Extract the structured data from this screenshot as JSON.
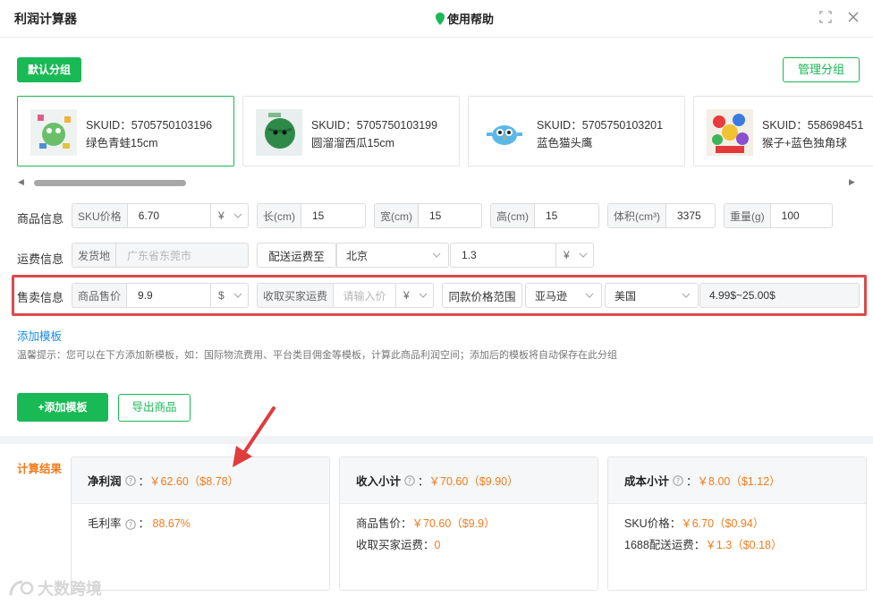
{
  "titlebar": {
    "title": "利润计算器",
    "help": "使用帮助"
  },
  "groups": {
    "default_label": "默认分组",
    "manage_label": "管理分组"
  },
  "products": [
    {
      "sku": "SKUID：5705750103196",
      "name": "绿色青蛙15cm"
    },
    {
      "sku": "SKUID：5705750103199",
      "name": "圆溜溜西瓜15cm"
    },
    {
      "sku": "SKUID：5705750103201",
      "name": "蓝色猫头鹰"
    },
    {
      "sku": "SKUID：558698451",
      "name": "猴子+蓝色独角球"
    }
  ],
  "product_info": {
    "label": "商品信息",
    "sku_price_label": "SKU价格",
    "sku_price": "6.70",
    "sku_currency": "¥",
    "length_label": "长(cm)",
    "length": "15",
    "width_label": "宽(cm)",
    "width": "15",
    "height_label": "高(cm)",
    "height": "15",
    "volume_label": "体积(cm³)",
    "volume": "3375",
    "weight_label": "重量(g)",
    "weight": "100"
  },
  "shipping_info": {
    "label": "运费信息",
    "origin_label": "发货地",
    "origin_placeholder": "广东省东莞市",
    "ship_to_label": "配送运费至",
    "ship_to": "北京",
    "fee": "1.3",
    "fee_currency": "¥"
  },
  "sale_info": {
    "label": "售卖信息",
    "price_label": "商品售价",
    "price": "9.9",
    "price_currency": "$",
    "buyer_fee_label": "收取买家运费",
    "buyer_fee_placeholder": "请输入价",
    "buyer_fee_currency": "¥",
    "range_label": "同款价格范围",
    "platform": "亚马逊",
    "country": "美国",
    "range": "4.99$~25.00$"
  },
  "add_template_link": "添加模板",
  "tip": "温馨提示：您可以在下方添加新模板，如：国际物流费用、平台类目佣金等模板，计算此商品利润空间；添加后的模板将自动保存在此分组",
  "actions": {
    "add_template": "+添加模板",
    "export": "导出商品"
  },
  "results": {
    "title": "计算结果",
    "net_profit": {
      "label": "净利润",
      "value": "￥62.60（$8.78）",
      "margin_label": "毛利率",
      "margin": "88.67%"
    },
    "income": {
      "label": "收入小计",
      "value": "￥70.60（$9.90）",
      "price_label": "商品售价：",
      "price": "￥70.60（$9.9）",
      "buyer_fee_label": "收取买家运费：",
      "buyer_fee": "0"
    },
    "cost": {
      "label": "成本小计",
      "value": "￥8.00（$1.12）",
      "sku_label": "SKU价格：",
      "sku": "￥6.70（$0.94）",
      "ship_label": "1688配送运费：",
      "ship": "￥1.3（$0.18）"
    }
  },
  "colors": {
    "brand_green": "#19b955",
    "accent_orange": "#f07c1e",
    "highlight_red": "#dd4a4a",
    "link_blue": "#1a8ce8"
  },
  "watermark": "大数跨境"
}
